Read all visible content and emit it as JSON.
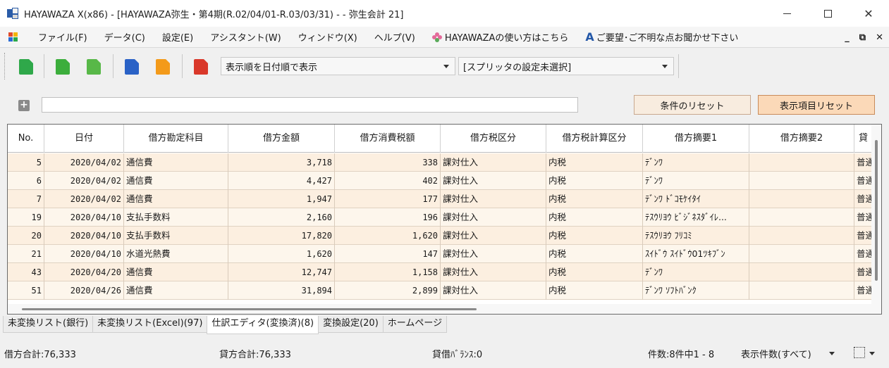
{
  "window": {
    "title": "HAYAWAZA X(x86) - [HAYAWAZA弥生・第4期(R.02/04/01-R.03/03/31) - - 弥生会計 21]"
  },
  "menu": {
    "items": [
      "ファイル(F)",
      "データ(C)",
      "設定(E)",
      "アシスタント(W)",
      "ウィンドウ(X)",
      "ヘルプ(V)"
    ],
    "howto_link": "HAYAWAZAの使い方はこちら",
    "feedback_link": "ご要望･ご不明な点お聞かせ下さい"
  },
  "toolbar": {
    "sort_combo": "表示順を日付順で表示",
    "splitter_combo": "[スプリッタの設定未選択]"
  },
  "filter": {
    "input_value": "",
    "reset_conditions": "条件のリセット",
    "reset_columns": "表示項目リセット"
  },
  "grid": {
    "headers": [
      "No.",
      "日付",
      "借方勘定科目",
      "借方金額",
      "借方消費税額",
      "借方税区分",
      "借方税計算区分",
      "借方摘要1",
      "借方摘要2",
      "貸"
    ],
    "rows": [
      {
        "no": "5",
        "date": "2020/04/02",
        "account": "通信費",
        "amount": "3,718",
        "tax": "338",
        "tax_class": "課対仕入",
        "tax_calc": "内税",
        "memo1": "ﾃﾞﾝﾜ",
        "memo2": "",
        "credit": "普通"
      },
      {
        "no": "6",
        "date": "2020/04/02",
        "account": "通信費",
        "amount": "4,427",
        "tax": "402",
        "tax_class": "課対仕入",
        "tax_calc": "内税",
        "memo1": "ﾃﾞﾝﾜ",
        "memo2": "",
        "credit": "普通"
      },
      {
        "no": "7",
        "date": "2020/04/02",
        "account": "通信費",
        "amount": "1,947",
        "tax": "177",
        "tax_class": "課対仕入",
        "tax_calc": "内税",
        "memo1": "ﾃﾞﾝﾜ ﾄﾞｺﾓｹｲﾀｲ",
        "memo2": "",
        "credit": "普通"
      },
      {
        "no": "19",
        "date": "2020/04/10",
        "account": "支払手数料",
        "amount": "2,160",
        "tax": "196",
        "tax_class": "課対仕入",
        "tax_calc": "内税",
        "memo1": "ﾃｽｳﾘﾖｳ ﾋﾞｼﾞﾈｽﾀﾞｲﾚ...",
        "memo2": "",
        "credit": "普通"
      },
      {
        "no": "20",
        "date": "2020/04/10",
        "account": "支払手数料",
        "amount": "17,820",
        "tax": "1,620",
        "tax_class": "課対仕入",
        "tax_calc": "内税",
        "memo1": "ﾃｽｳﾘﾖｳ ﾌﾘｺﾐ",
        "memo2": "",
        "credit": "普通"
      },
      {
        "no": "21",
        "date": "2020/04/10",
        "account": "水道光熱費",
        "amount": "1,620",
        "tax": "147",
        "tax_class": "課対仕入",
        "tax_calc": "内税",
        "memo1": "ｽｲﾄﾞｳ ｽｲﾄﾞｳ01ﾂｷﾌﾞﾝ",
        "memo2": "",
        "credit": "普通"
      },
      {
        "no": "43",
        "date": "2020/04/20",
        "account": "通信費",
        "amount": "12,747",
        "tax": "1,158",
        "tax_class": "課対仕入",
        "tax_calc": "内税",
        "memo1": "ﾃﾞﾝﾜ",
        "memo2": "",
        "credit": "普通"
      },
      {
        "no": "51",
        "date": "2020/04/26",
        "account": "通信費",
        "amount": "31,894",
        "tax": "2,899",
        "tax_class": "課対仕入",
        "tax_calc": "内税",
        "memo1": "ﾃﾞﾝﾜ ｿﾌﾄﾊﾞﾝｸ",
        "memo2": "",
        "credit": "普通"
      }
    ]
  },
  "tabs": [
    "未変換リスト(銀行)",
    "未変換リスト(Excel)(97)",
    "仕訳エディタ(変換済)(8)",
    "変換設定(20)",
    "ホームページ"
  ],
  "status": {
    "debit_total": "借方合計:76,333",
    "credit_total": "貸方合計:76,333",
    "balance": "貸借ﾊﾞﾗﾝｽ:0",
    "count": "件数:8件中1 - 8",
    "display_count": "表示件数(すべて)"
  },
  "colors": {
    "row_odd": "#fcefe0",
    "row_even": "#fdf6ec",
    "reset_button": "#f8ecdf",
    "reset_button_active": "#fbd9b8"
  }
}
